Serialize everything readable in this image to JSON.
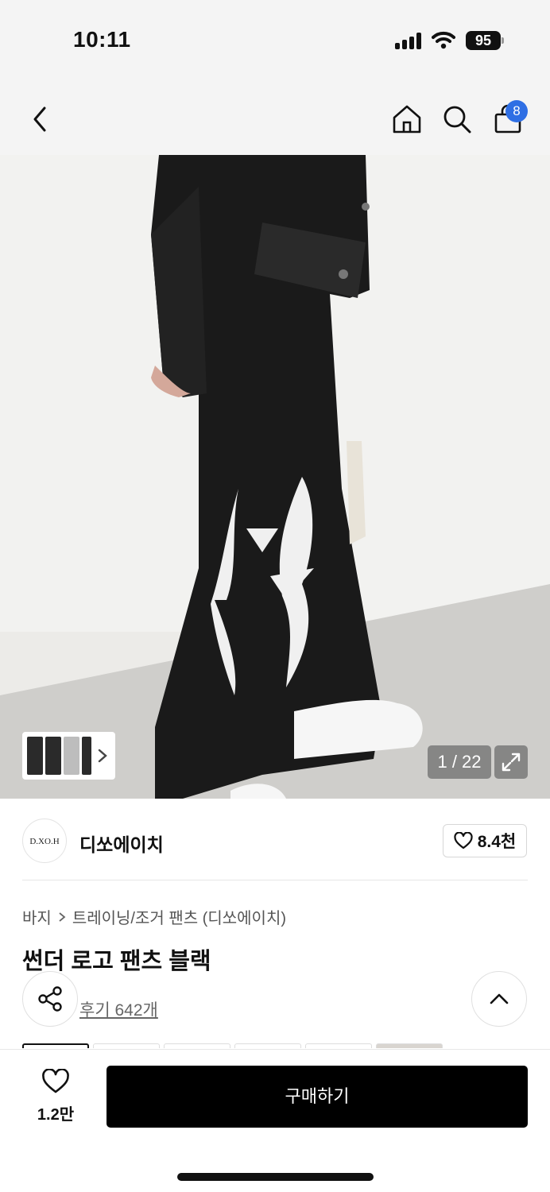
{
  "status_bar": {
    "time": "10:11",
    "battery": "95",
    "icons": [
      "cellular-signal-icon",
      "wifi-icon",
      "battery-icon"
    ]
  },
  "nav": {
    "icons": [
      "back-chevron-icon",
      "home-icon",
      "search-icon",
      "shopping-bag-icon"
    ],
    "cart_count": "8"
  },
  "gallery": {
    "counter": "1 / 22",
    "icons": [
      "chevron-right-icon",
      "expand-icon"
    ]
  },
  "brand": {
    "logo_text": "D.XO.H",
    "name": "디쏘에이치",
    "likes": "8.4천"
  },
  "product": {
    "breadcrumb": [
      "바지",
      "트레이닝/조거 팬츠 (디쏘에이치)"
    ],
    "title": "썬더 로고 팬츠 블랙",
    "reviews": "후기 642개"
  },
  "bottom": {
    "wish_count": "1.2만",
    "buy_label": "구매하기"
  },
  "colors": {
    "accent_badge": "#2f6fe4",
    "buy_button": "#000000"
  }
}
